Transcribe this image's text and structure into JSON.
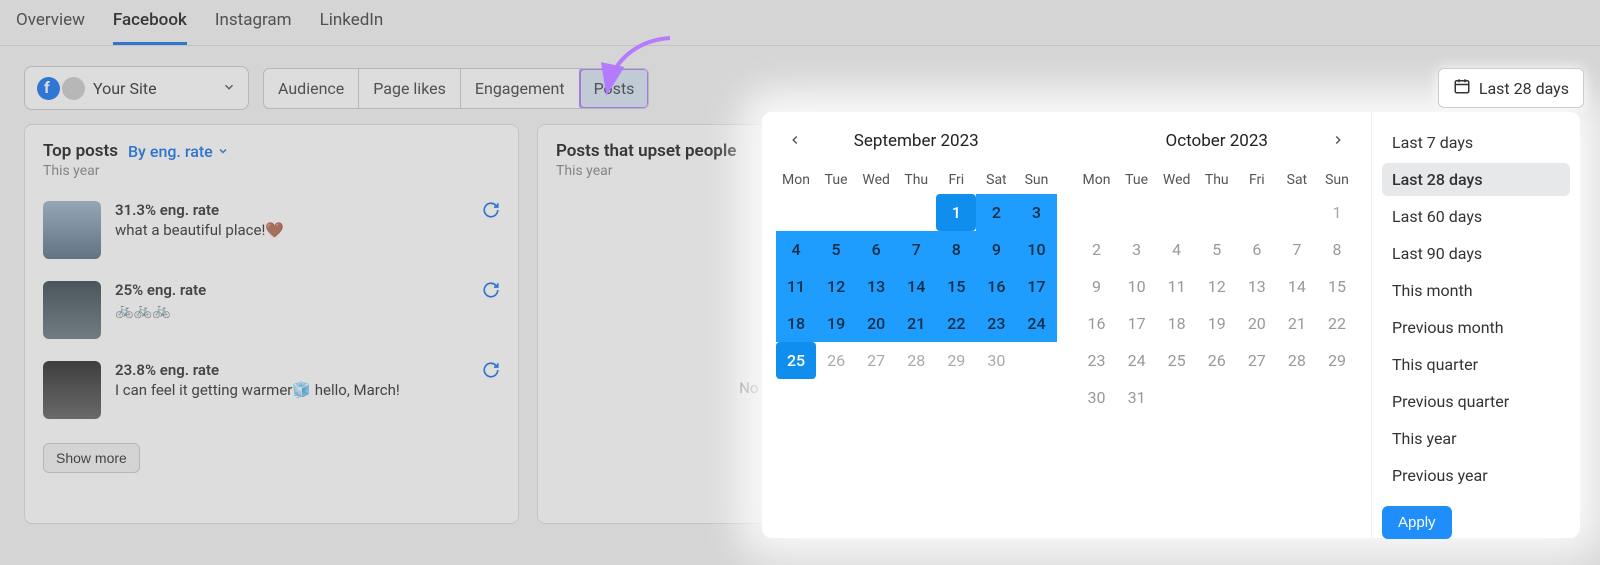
{
  "mainTabs": [
    "Overview",
    "Facebook",
    "Instagram",
    "LinkedIn"
  ],
  "mainTabActive": "Facebook",
  "siteDropdown": {
    "label": "Your Site"
  },
  "subTabs": [
    "Audience",
    "Page likes",
    "Engagement",
    "Posts"
  ],
  "subTabActive": "Posts",
  "dateButton": {
    "label": "Last 28 days"
  },
  "topPostsCard": {
    "title": "Top posts",
    "sortLabel": "By eng. rate",
    "subNote": "This year",
    "posts": [
      {
        "rate": "31.3% eng. rate",
        "caption": "what a beautiful place!🤎"
      },
      {
        "rate": "25% eng. rate",
        "caption": "🚲🚲🚲"
      },
      {
        "rate": "23.8% eng. rate",
        "caption": "I can feel it getting warmer🧊 hello, March!"
      }
    ],
    "showMore": "Show more"
  },
  "upsetCard": {
    "title": "Posts that upset people",
    "subNote": "This year",
    "emptyText": "No one's com"
  },
  "picker": {
    "months": {
      "left": {
        "label": "September 2023"
      },
      "right": {
        "label": "October 2023"
      }
    },
    "dow": [
      "Mon",
      "Tue",
      "Wed",
      "Thu",
      "Fri",
      "Sat",
      "Sun"
    ],
    "sept": {
      "leadingBlanks": 4,
      "days": 30,
      "selStart": 1,
      "selEnd": 25
    },
    "oct": {
      "leadingDim": [
        1
      ],
      "days": 31
    },
    "presets": [
      "Last 7 days",
      "Last 28 days",
      "Last 60 days",
      "Last 90 days",
      "This month",
      "Previous month",
      "This quarter",
      "Previous quarter",
      "This year",
      "Previous year"
    ],
    "presetActive": "Last 28 days",
    "applyLabel": "Apply"
  }
}
